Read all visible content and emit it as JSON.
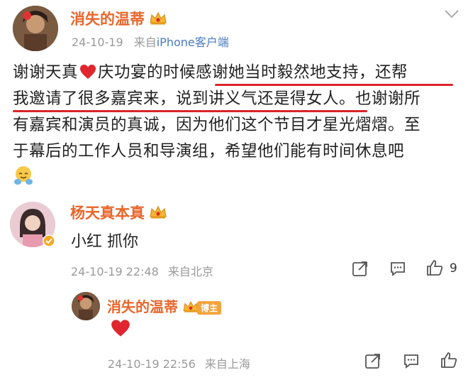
{
  "post": {
    "author": "消失的温蒂",
    "meta_time": "24-10-19",
    "meta_from": "来自",
    "meta_client": "iPhone客户端",
    "body_lines": [
      "谢谢天真❤️庆功宴的时候感谢她当时毅然地支持，还帮",
      "我邀请了很多嘉宾来，说到讲义气还是得女人。也谢谢所",
      "有嘉宾和演员的真诚，因为他们这个节目才星光熠熠。至",
      "于幕后的工作人员和导演组，希望他们能有时间休息吧"
    ],
    "body_segments": {
      "line1_a": "谢谢天真",
      "line1_b": "庆功宴的时候感谢她当时毅然地支持，还帮",
      "line2": "我邀请了很多嘉宾来，说到讲义气还是得女人。也谢谢所",
      "line3": "有嘉宾和演员的真诚，因为他们这个节目才星光熠熠。至",
      "line4": "于幕后的工作人员和导演组，希望他们能有时间休息吧"
    },
    "end_emoji": "hug-emoji"
  },
  "comment": {
    "author": "杨天真本真",
    "text": "小红 抓你",
    "time": "24-10-19 22:48",
    "location": "来自北京",
    "like_count": "9"
  },
  "reply": {
    "author": "消失的温蒂",
    "badge": "博主",
    "text_emoji": "red-heart",
    "time": "24-10-19 22:56",
    "location": "来自上海"
  },
  "colors": {
    "name": "#e8662b",
    "meta_link": "#4a7bbd",
    "underline": "#d9242b",
    "heart": "#e0262e"
  }
}
